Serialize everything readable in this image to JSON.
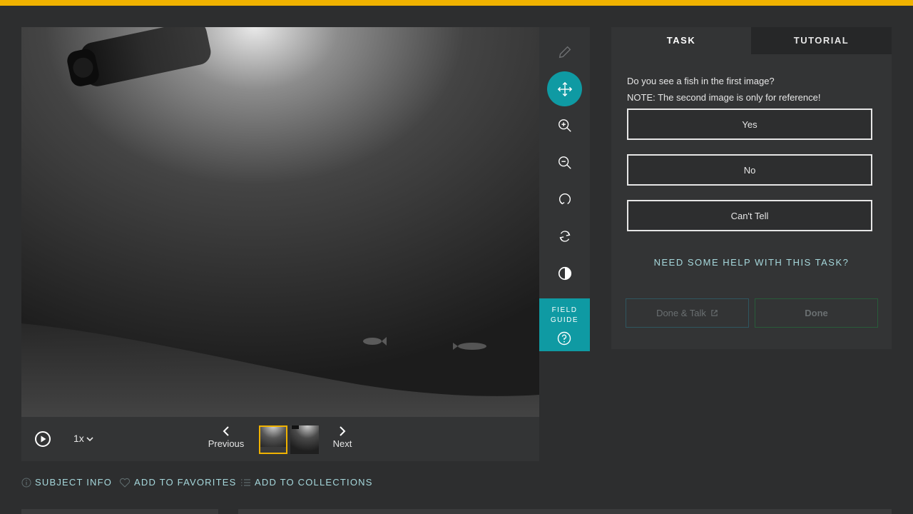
{
  "colors": {
    "accent_bar": "#f0b200",
    "teal": "#0f9aa3",
    "link": "#a6d8dc",
    "background": "#2d2e2f",
    "panel": "#333435"
  },
  "viewer": {
    "playback_speed": "1x",
    "previous_label": "Previous",
    "next_label": "Next",
    "selected_frame": 1,
    "frame_count": 2
  },
  "toolbar": {
    "icons": [
      "pencil-icon",
      "move-icon",
      "zoom-in-icon",
      "zoom-out-icon",
      "rotate-icon",
      "reset-icon",
      "invert-icon"
    ],
    "active_tool": "move-icon",
    "field_guide_line1": "FIELD",
    "field_guide_line2": "GUIDE"
  },
  "task": {
    "tab_task": "TASK",
    "tab_tutorial": "TUTORIAL",
    "question_line1": "Do you see a fish in the first image?",
    "question_line2": "NOTE: The second image is only for reference!",
    "answers": [
      "Yes",
      "No",
      "Can't Tell"
    ],
    "help_link": "NEED SOME HELP WITH THIS TASK?",
    "done_talk_label": "Done & Talk",
    "done_label": "Done"
  },
  "meta": {
    "subject_info": "SUBJECT INFO",
    "add_favorites": "ADD TO FAVORITES",
    "add_collections": "ADD TO COLLECTIONS"
  }
}
